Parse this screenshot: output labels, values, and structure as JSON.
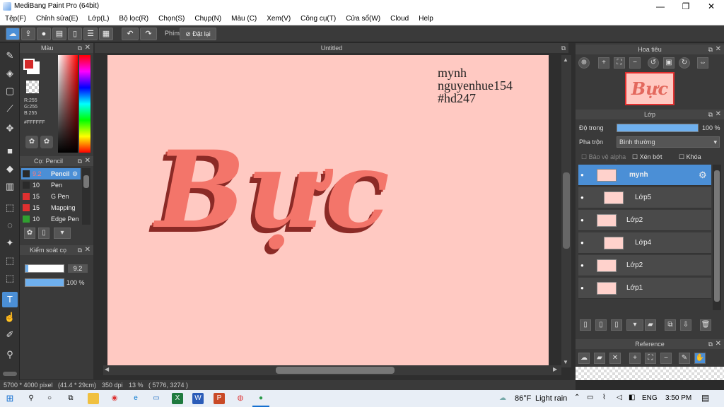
{
  "window": {
    "title": "MediBang Paint Pro (64bit)",
    "minimize": "—",
    "maximize": "❐",
    "close": "✕"
  },
  "menu": [
    "Tệp(F)",
    "Chỉnh sửa(E)",
    "Lớp(L)",
    "Bộ lọc(R)",
    "Chọn(S)",
    "Chụp(N)",
    "Màu (C)",
    "Xem(V)",
    "Công cụ(T)",
    "Cửa sổ(W)",
    "Cloud",
    "Help"
  ],
  "toolbar": {
    "shortcut_label": "Phím",
    "reset_label": "Đặt lại"
  },
  "color_panel": {
    "title": "Màu",
    "r": "R:255",
    "g": "G:255",
    "b": "B:255",
    "hex": "#FFFFFF",
    "primary_color": "#d42a2a",
    "secondary_color": "#ffffff"
  },
  "brush_panel": {
    "title": "Cọ: Pencil",
    "items": [
      {
        "size": "9.2",
        "name": "Pencil",
        "color": "#2a2a2a"
      },
      {
        "size": "10",
        "name": "Pen",
        "color": "#2a2a2a"
      },
      {
        "size": "15",
        "name": "G Pen",
        "color": "#e03030"
      },
      {
        "size": "15",
        "name": "Mapping P",
        "color": "#e03030"
      },
      {
        "size": "10",
        "name": "Edge Pen",
        "color": "#30a030"
      }
    ]
  },
  "control_panel": {
    "title": "Kiểm soát cọ",
    "size": "9.2",
    "opacity": "100 %",
    "size_fill": 0.08,
    "opacity_fill": 1.0
  },
  "document": {
    "title": "Untitled",
    "watermark": [
      "mynh",
      "nguyenhue154",
      "#hd247"
    ],
    "art_text": "Bực"
  },
  "status": {
    "dims": "5700 * 4000 pixel",
    "cm": "(41.4 * 29cm)",
    "dpi": "350 dpi",
    "zoom": "13 %",
    "coords": "( 5776, 3274 )"
  },
  "navigator": {
    "title": "Hoa tiêu",
    "thumb_text": "Bực"
  },
  "layers_panel": {
    "title": "Lớp",
    "opacity_label": "Độ trong",
    "opacity_value": "100 %",
    "opacity_fill": 1.0,
    "blend_label": "Pha trộn",
    "blend_value": "Bình thường",
    "protect_alpha": "Bảo vệ alpha",
    "clipping": "Xén bớt",
    "lock": "Khóa",
    "layers": [
      {
        "name": "mynh",
        "selected": true,
        "indent": 0
      },
      {
        "name": "Lớp5",
        "selected": false,
        "indent": 1
      },
      {
        "name": "Lớp2",
        "selected": false,
        "indent": 0
      },
      {
        "name": "Lớp4",
        "selected": false,
        "indent": 1
      },
      {
        "name": "Lớp2",
        "selected": false,
        "indent": 0
      },
      {
        "name": "Lớp1",
        "selected": false,
        "indent": 0
      }
    ]
  },
  "reference": {
    "title": "Reference"
  },
  "taskbar": {
    "weather_temp": "86°F",
    "weather_text": "Light rain",
    "lang": "ENG",
    "time": "3:50 PM"
  }
}
